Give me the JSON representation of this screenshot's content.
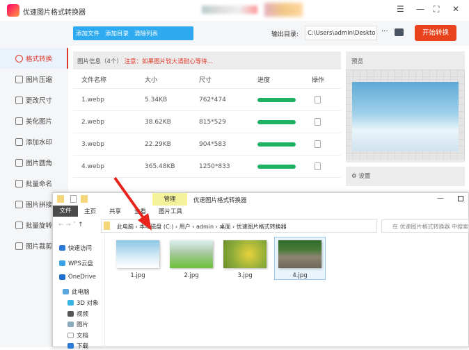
{
  "app": {
    "title": "优速图片格式转换器"
  },
  "toolbar": {
    "add_file": "添加文件",
    "add_dir": "添加目录",
    "clear_list": "清除列表",
    "output_label": "输出目录:",
    "output_path": "C:\\Users\\admin\\Deskto",
    "more": "···",
    "start": "开始转换"
  },
  "sidebar": {
    "items": [
      "格式转换",
      "图片压缩",
      "更改尺寸",
      "美化图片",
      "添加水印",
      "图片圆角",
      "批量命名",
      "图片拼接",
      "批量旋转",
      "图片裁剪"
    ]
  },
  "table": {
    "info": "图片信息（4个）",
    "note": "注意：如果图片较大请耐心等待...",
    "headers": [
      "文件名称",
      "大小",
      "尺寸",
      "进度",
      "操作"
    ],
    "rows": [
      {
        "name": "1.webp",
        "size": "5.34KB",
        "dims": "762*474",
        "progress": 100
      },
      {
        "name": "2.webp",
        "size": "38.62KB",
        "dims": "815*529",
        "progress": 100
      },
      {
        "name": "3.webp",
        "size": "22.29KB",
        "dims": "904*583",
        "progress": 100
      },
      {
        "name": "4.webp",
        "size": "365.48KB",
        "dims": "1250*833",
        "progress": 100
      }
    ]
  },
  "preview": {
    "label": "预览"
  },
  "settings": {
    "label": "设置"
  },
  "explorer": {
    "title": "优速图片格式转换器",
    "manage": "管理",
    "tabs": [
      "文件",
      "主页",
      "共享",
      "查看",
      "图片工具"
    ],
    "path": [
      "此电脑",
      "本地磁盘 (C:)",
      "用户",
      "admin",
      "桌面",
      "优速图片格式转换器"
    ],
    "search_placeholder": "在 优速图片格式转换器 中搜索",
    "nav": [
      "快速访问",
      "WPS云盘",
      "OneDrive",
      "此电脑",
      "3D 对象",
      "视频",
      "图片",
      "文档",
      "下载"
    ],
    "files": [
      "1.jpg",
      "2.jpg",
      "3.jpg",
      "4.jpg"
    ]
  },
  "colors": {
    "accent": "#e8431c",
    "blue": "#2eaaf0",
    "progress": "#1db366"
  }
}
